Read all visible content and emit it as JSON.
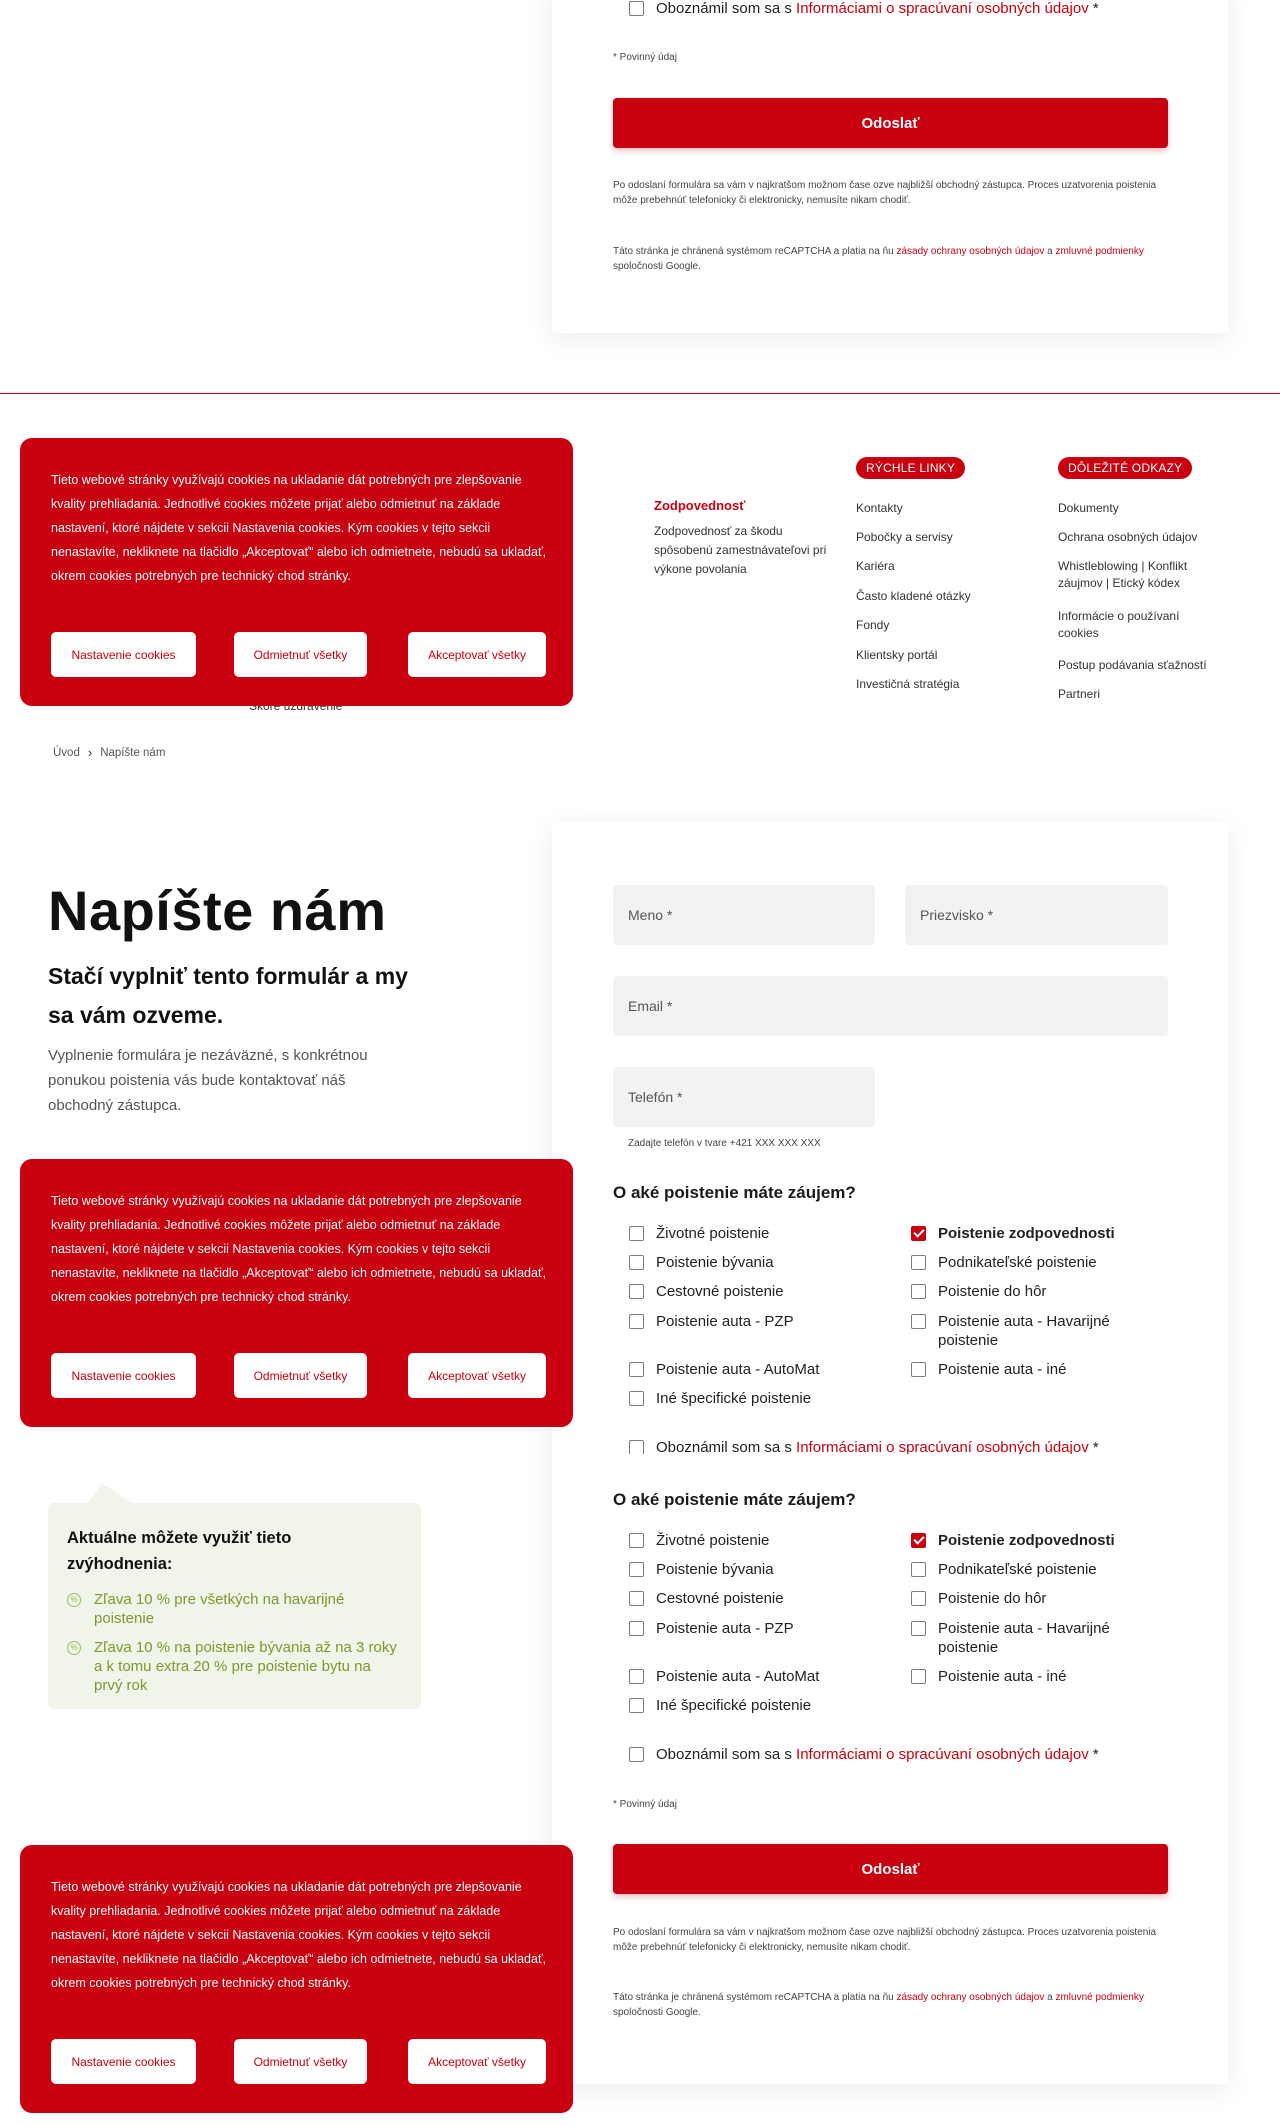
{
  "top_form": {
    "consent_prefix": "Oboznámil som sa s ",
    "consent_link": "Informáciami o spracúvaní osobných údajov",
    "consent_suffix": " *",
    "required_note": "* Povinný údaj",
    "submit_label": "Odoslať",
    "after_submit": "Po odoslaní formulára sa vám v najkratšom možnom čase ozve najbližší obchodný zástupca. Proces uzatvorenia poistenia môže prebehnúť telefonicky či elektronicky, nemusíte nikam chodiť.",
    "recaptcha_prefix": "Táto stránka je chránená systémom reCAPTCHA a platia na ňu ",
    "recaptcha_link1": "zásady ochrany osobných údajov",
    "recaptcha_mid": " a ",
    "recaptcha_link2": "zmluvné podmienky",
    "recaptcha_suffix": " spoločnosti Google."
  },
  "footer": {
    "liability_title": "Zodpovednosť",
    "liability_text": "Zodpovednosť za škodu spôsobenú zamestnávateľovi pri výkone povolania",
    "hidden_text": "Skóre uzdravenie",
    "quick_links_title": "RÝCHLE LINKY",
    "quick_links": [
      "Kontakty",
      "Pobočky a servisy",
      "Kariéra",
      "Často kladené otázky",
      "Fondy",
      "Klientsky portál",
      "Investičná stratégia"
    ],
    "important_title": "DÔLEŽITÉ ODKAZY",
    "important_links": [
      "Dokumenty",
      "Ochrana osobných údajov",
      "Whistleblowing | Konflikt záujmov | Etický kódex",
      "Informácie o používaní cookies",
      "Postup podávania sťažností",
      "Partneri"
    ]
  },
  "cookie": {
    "text": "Tieto webové stránky využívajú cookies na ukladanie dát potrebných pre zlepšovanie kvality prehliadania. Jednotlivé cookies môžete prijať alebo odmietnuť na základe nastavení, ktoré nájdete v sekcii Nastavenia cookies. Kým cookies v tejto sekcii nenastavíte, nekliknete na tlačidlo „Akceptovať“ alebo ich odmietnete, nebudú sa ukladať, okrem cookies potrebných pre technický chod stránky.",
    "settings_label": "Nastavenie cookies",
    "reject_label": "Odmietnuť všetky",
    "accept_label": "Akceptovať všetky"
  },
  "breadcrumb": {
    "home": "Úvod",
    "current": "Napíšte nám"
  },
  "hero": {
    "title": "Napíšte nám",
    "subtitle": "Stačí vyplniť tento formulár a my sa vám ozveme.",
    "description": "Vyplnenie formulára je nezáväzné, s konkrétnou ponukou poistenia vás bude kontaktovať náš obchodný zástupca."
  },
  "form": {
    "first_name_placeholder": "Meno *",
    "last_name_placeholder": "Priezvisko *",
    "email_placeholder": "Email *",
    "phone_placeholder": "Telefón *",
    "phone_hint": "Zadajte telefón v tvare +421 XXX XXX XXX",
    "question": "O aké poistenie máte záujem?",
    "options_left": [
      "Životné poistenie",
      "Poistenie bývania",
      "Cestovné poistenie",
      "Poistenie auta - PZP",
      "Poistenie auta - AutoMat",
      "Iné špecifické poistenie"
    ],
    "options_right": [
      "Poistenie zodpovednosti",
      "Podnikateľské poistenie",
      "Poistenie do hôr",
      "Poistenie auta - Havarijné poistenie",
      "Poistenie auta - iné"
    ],
    "checked_option": "Poistenie zodpovednosti"
  },
  "promo": {
    "title": "Aktuálne môžete využiť tieto zvýhodnenia:",
    "perks": [
      "Zľava 10 % pre všetkých na havarijné poistenie",
      "Zľava 10 % na poistenie bývania až na 3 roky a k tomu extra 20 % pre poistenie bytu na prvý rok"
    ]
  },
  "colors": {
    "brand_red": "#c8000f",
    "promo_green": "#7a9a2e",
    "promo_bg": "#f1f4e8"
  }
}
